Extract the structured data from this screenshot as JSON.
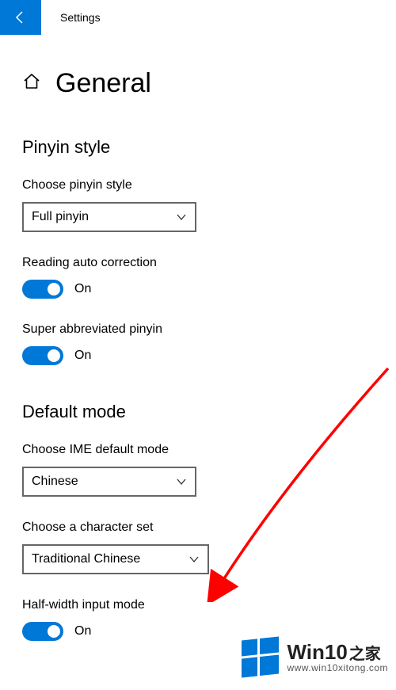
{
  "titlebar": {
    "label": "Settings"
  },
  "page": {
    "title": "General"
  },
  "pinyin": {
    "heading": "Pinyin style",
    "choose_label": "Choose pinyin style",
    "choose_value": "Full pinyin",
    "reading_label": "Reading auto correction",
    "reading_state": "On",
    "super_label": "Super abbreviated pinyin",
    "super_state": "On"
  },
  "defaultmode": {
    "heading": "Default mode",
    "ime_label": "Choose IME default mode",
    "ime_value": "Chinese",
    "charset_label": "Choose a character set",
    "charset_value": "Traditional Chinese",
    "half_label": "Half-width input mode",
    "half_state": "On"
  },
  "watermark": {
    "brand": "Win10",
    "brand_zh": "之家",
    "url": "www.win10xitong.com"
  }
}
